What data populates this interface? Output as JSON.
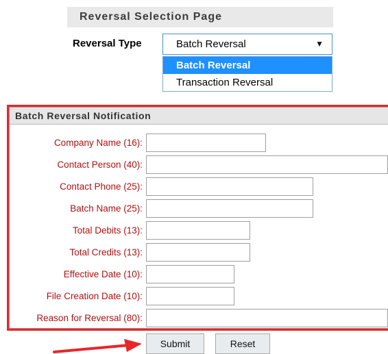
{
  "header": {
    "title": "Reversal Selection Page"
  },
  "reversal_type": {
    "label": "Reversal Type",
    "selected": "Batch Reversal",
    "options": [
      "Batch Reversal",
      "Transaction Reversal"
    ]
  },
  "notification": {
    "title": "Batch Reversal Notification",
    "fields": [
      {
        "label": "Company Name (16):",
        "value": ""
      },
      {
        "label": "Contact Person (40):",
        "value": ""
      },
      {
        "label": "Contact Phone (25):",
        "value": ""
      },
      {
        "label": "Batch Name (25):",
        "value": ""
      },
      {
        "label": "Total Debits (13):",
        "value": ""
      },
      {
        "label": "Total Credits (13):",
        "value": ""
      },
      {
        "label": "Effective Date (10):",
        "value": ""
      },
      {
        "label": "File Creation Date (10):",
        "value": ""
      },
      {
        "label": "Reason for Reversal (80):",
        "value": ""
      }
    ]
  },
  "actions": {
    "submit_label": "Submit",
    "reset_label": "Reset"
  },
  "colors": {
    "highlight_border": "#e8262a",
    "label_text": "#b01010",
    "selected_option": "#1e90ff"
  },
  "icons": {
    "dropdown": "caret-down-icon",
    "annotation": "red-arrow-icon"
  }
}
